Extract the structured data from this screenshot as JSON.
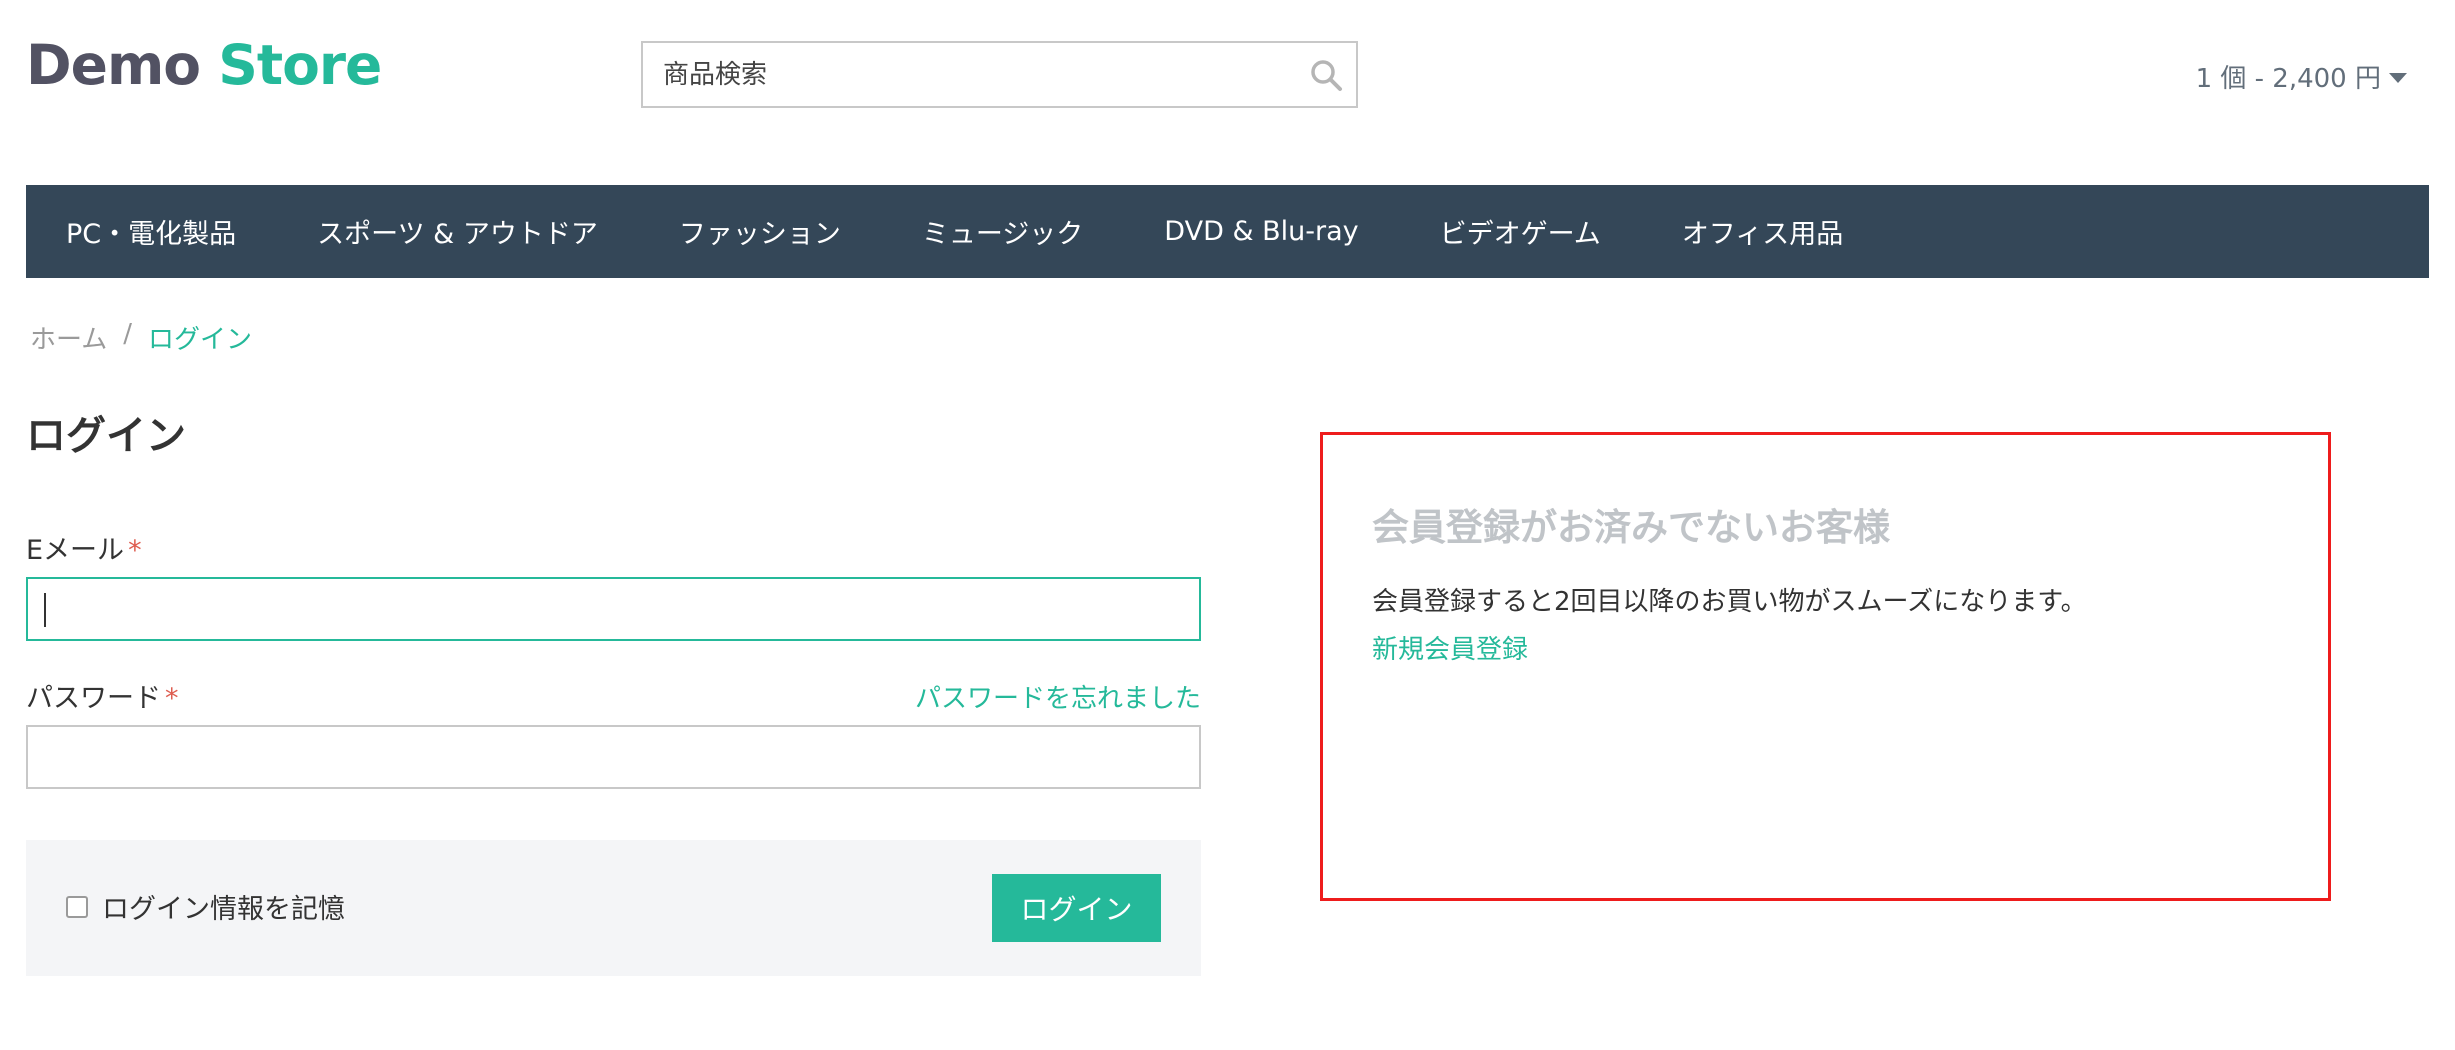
{
  "header": {
    "logo_part1": "Demo",
    "logo_part2": "Store",
    "search_placeholder": "商品検索",
    "cart_summary": "1 個 - 2,400 円"
  },
  "nav": {
    "items": [
      "PC・電化製品",
      "スポーツ & アウトドア",
      "ファッション",
      "ミュージック",
      "DVD & Blu-ray",
      "ビデオゲーム",
      "オフィス用品"
    ]
  },
  "breadcrumb": {
    "home": "ホーム",
    "separator": "/",
    "current": "ログイン"
  },
  "login": {
    "title": "ログイン",
    "email_label": "Eメール",
    "password_label": "パスワード",
    "required_mark": "*",
    "forgot_password": "パスワードを忘れました",
    "remember_label": "ログイン情報を記憶",
    "submit_label": "ログイン"
  },
  "guest": {
    "title": "会員登録がお済みでないお客様",
    "text": "会員登録すると2回目以降のお買い物がスムーズになります。",
    "register_link": "新規会員登録"
  },
  "colors": {
    "accent": "#25b99a",
    "nav_bg": "#344758",
    "highlight_border": "#ee1c1c",
    "required": "#de5d50"
  }
}
